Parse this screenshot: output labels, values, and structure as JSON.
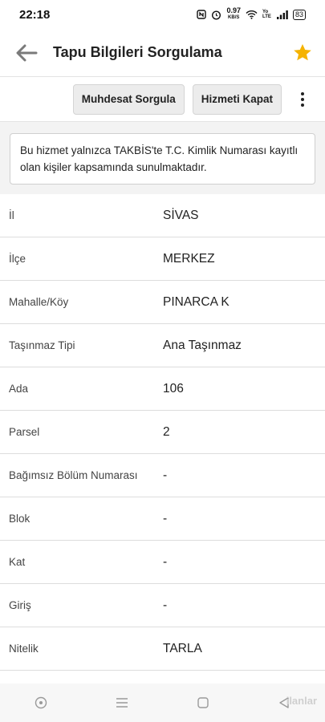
{
  "status": {
    "time": "22:18",
    "net_speed_value": "0.97",
    "net_speed_unit": "KB/S",
    "volte": "Yo LTE",
    "battery": "83"
  },
  "header": {
    "title": "Tapu Bilgileri Sorgulama"
  },
  "actions": {
    "muhdesat_label": "Muhdesat Sorgula",
    "close_service_label": "Hizmeti Kapat"
  },
  "notice": "Bu hizmet yalnızca TAKBİS'te T.C. Kimlik Numarası kayıtlı olan kişiler kapsamında sunulmaktadır.",
  "rows": [
    {
      "label": "İl",
      "value": "SİVAS"
    },
    {
      "label": "İlçe",
      "value": "MERKEZ"
    },
    {
      "label": "Mahalle/Köy",
      "value": "PINARCA K"
    },
    {
      "label": "Taşınmaz Tipi",
      "value": "Ana Taşınmaz"
    },
    {
      "label": "Ada",
      "value": "106"
    },
    {
      "label": "Parsel",
      "value": "2"
    },
    {
      "label": "Bağımsız Bölüm Numarası",
      "value": "-"
    },
    {
      "label": "Blok",
      "value": "-"
    },
    {
      "label": "Kat",
      "value": "-"
    },
    {
      "label": "Giriş",
      "value": "-"
    },
    {
      "label": "Nitelik",
      "value": "TARLA"
    }
  ],
  "watermark": "ilanlar",
  "colors": {
    "star": "#f5b301",
    "back_arrow": "#7a7a7a",
    "button_bg": "#ececec"
  }
}
